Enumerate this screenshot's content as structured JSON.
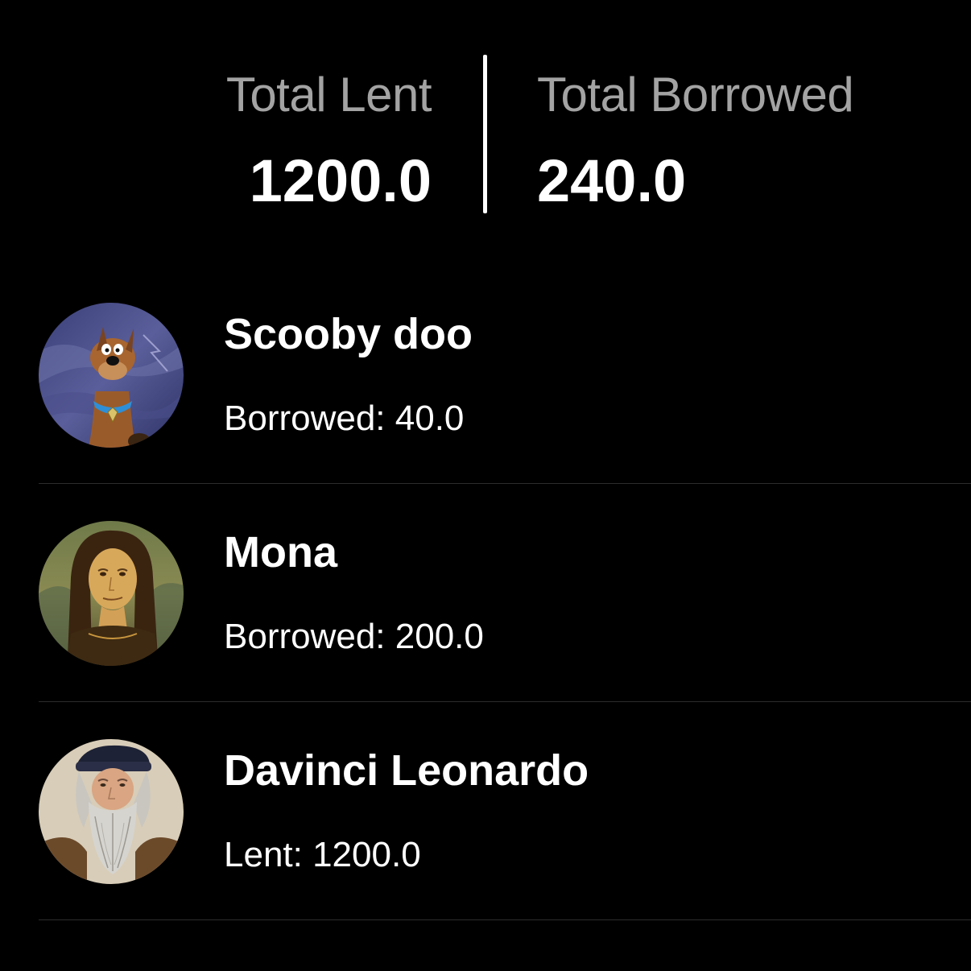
{
  "summary": {
    "lent_label": "Total Lent",
    "lent_value": "1200.0",
    "borrowed_label": "Total Borrowed",
    "borrowed_value": "240.0"
  },
  "contacts": [
    {
      "name": "Scooby doo",
      "detail": "Borrowed: 40.0",
      "avatar_icon": "scooby-doo-avatar"
    },
    {
      "name": "Mona",
      "detail": "Borrowed: 200.0",
      "avatar_icon": "mona-lisa-avatar"
    },
    {
      "name": "Davinci Leonardo",
      "detail": "Lent: 1200.0",
      "avatar_icon": "leonardo-avatar"
    }
  ],
  "colors": {
    "background": "#000000",
    "label_gray": "#a3a3a3",
    "text_white": "#ffffff",
    "separator": "#2c2c2e"
  }
}
